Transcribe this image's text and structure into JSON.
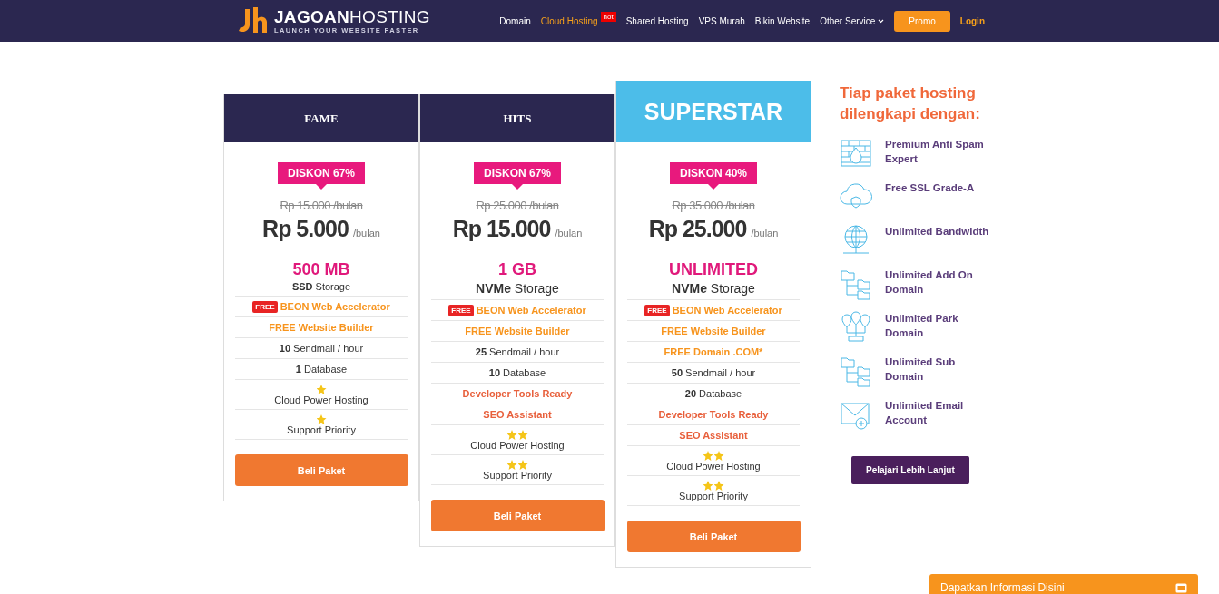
{
  "nav": {
    "logo": "**JAGOAN**HOSTING",
    "tagline": "LAUNCH YOUR WEBSITE FASTER",
    "items": [
      {
        "label": "Domain",
        "selected": false
      },
      {
        "label": "Cloud Hosting",
        "selected": true,
        "badge": "hot"
      },
      {
        "label": "Shared Hosting",
        "selected": false
      },
      {
        "label": "VPS Murah",
        "selected": false
      },
      {
        "label": "Bikin Website",
        "selected": false
      },
      {
        "label": "Other Service",
        "selected": false,
        "dropdown": true
      }
    ],
    "promo": "Promo",
    "login": "Login"
  },
  "plans": [
    {
      "name": "FAME",
      "featured": false,
      "discount": "DISKON 67%",
      "old_price": "Rp 15.000 /bulan",
      "price": "Rp 5.000",
      "period": "/bulan",
      "storage": "500 MB",
      "storage_label": "**SSD** Storage",
      "features": [
        {
          "kind": "free",
          "badge": "FREE",
          "text": "BEON Web Accelerator"
        },
        {
          "kind": "highlight",
          "text": "FREE Website Builder"
        },
        {
          "kind": "count",
          "text": "**10** Sendmail / hour"
        },
        {
          "kind": "count",
          "text": "**1** Database"
        },
        {
          "kind": "stars",
          "icons": [
            {
              "kind": "star"
            }
          ],
          "text": "Cloud Power Hosting"
        },
        {
          "kind": "stars",
          "icons": [
            {
              "kind": "star"
            }
          ],
          "text": "Support Priority"
        }
      ],
      "button": "Beli Paket"
    },
    {
      "name": "HITS",
      "featured": false,
      "discount": "DISKON 67%",
      "old_price": "Rp 25.000 /bulan",
      "price": "Rp 15.000",
      "period": "/bulan",
      "storage": "1 GB",
      "storage_label": "**NVMe** Storage",
      "features": [
        {
          "kind": "free",
          "badge": "FREE",
          "text": "BEON Web Accelerator"
        },
        {
          "kind": "highlight",
          "text": "FREE Website Builder"
        },
        {
          "kind": "count",
          "text": "**25** Sendmail / hour"
        },
        {
          "kind": "count",
          "text": "**10** Database"
        },
        {
          "kind": "accent",
          "text": "Developer Tools Ready"
        },
        {
          "kind": "accent",
          "text": "SEO Assistant"
        },
        {
          "kind": "stars",
          "icons": [
            {
              "kind": "star"
            },
            {
              "kind": "star"
            }
          ],
          "text": "Cloud Power Hosting"
        },
        {
          "kind": "stars",
          "icons": [
            {
              "kind": "star"
            },
            {
              "kind": "star"
            }
          ],
          "text": "Support Priority"
        }
      ],
      "button": "Beli Paket"
    },
    {
      "name": "SUPERSTAR",
      "featured": true,
      "discount": "DISKON 40%",
      "old_price": "Rp 35.000 /bulan",
      "price": "Rp 25.000",
      "period": "/bulan",
      "storage": "UNLIMITED",
      "storage_label": "**NVMe** Storage",
      "features": [
        {
          "kind": "free",
          "badge": "FREE",
          "text": "BEON Web Accelerator"
        },
        {
          "kind": "highlight",
          "text": "FREE Website Builder"
        },
        {
          "kind": "highlight",
          "text": "FREE Domain .COM*"
        },
        {
          "kind": "count",
          "text": "**50** Sendmail / hour"
        },
        {
          "kind": "count",
          "text": "**20** Database"
        },
        {
          "kind": "accent",
          "text": "Developer Tools Ready"
        },
        {
          "kind": "accent",
          "text": "SEO Assistant"
        },
        {
          "kind": "stars",
          "icons": [
            {
              "kind": "star"
            },
            {
              "kind": "star"
            }
          ],
          "text": "Cloud Power Hosting"
        },
        {
          "kind": "stars",
          "icons": [
            {
              "kind": "star"
            },
            {
              "kind": "star"
            }
          ],
          "text": "Support Priority"
        }
      ],
      "button": "Beli Paket"
    }
  ],
  "includes": {
    "title": "Tiap paket hosting dilengkapi dengan:",
    "items": [
      {
        "kind": "firewall",
        "text": "Premium Anti Spam Expert"
      },
      {
        "kind": "cloud",
        "text": "Free SSL Grade-A"
      },
      {
        "kind": "globe",
        "text": "Unlimited Bandwidth"
      },
      {
        "kind": "folders",
        "text": "Unlimited Add On Domain"
      },
      {
        "kind": "pins",
        "text": "Unlimited Park Domain"
      },
      {
        "kind": "folders",
        "text": "Unlimited Sub Domain"
      },
      {
        "kind": "mail",
        "text": "Unlimited Email Account"
      }
    ],
    "button": "Pelajari Lebih Lanjut"
  },
  "chat": {
    "label": "Dapatkan Informasi Disini"
  }
}
